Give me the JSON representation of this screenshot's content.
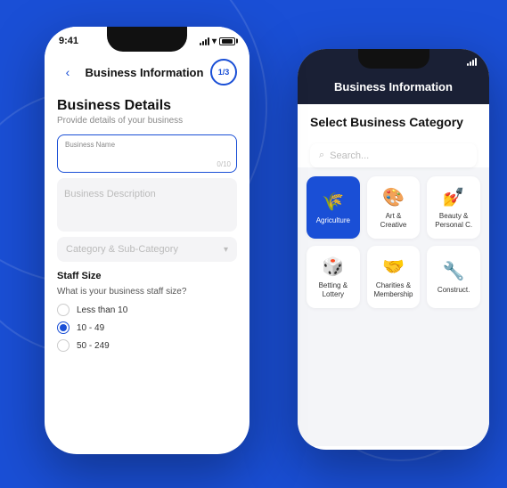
{
  "background_color": "#1a4fd6",
  "phone_main": {
    "status_bar": {
      "time": "9:41"
    },
    "header": {
      "back_label": "‹",
      "title": "Business Information",
      "step": "1/3"
    },
    "content": {
      "section_title": "Business Details",
      "section_subtitle": "Provide details of your business",
      "business_name_label": "Business Name",
      "business_name_value": "",
      "business_name_count": "0/10",
      "business_description_placeholder": "Business Description",
      "category_placeholder": "Category & Sub-Category",
      "staff_label": "Staff Size",
      "staff_question": "What is your business staff size?",
      "radio_options": [
        {
          "label": "Less than 10",
          "selected": false
        },
        {
          "label": "10 - 49",
          "selected": true
        },
        {
          "label": "50 - 249",
          "selected": false
        }
      ]
    }
  },
  "phone_secondary": {
    "header": {
      "title": "Business Information"
    },
    "content": {
      "section_title": "Select Business Category",
      "search_placeholder": "Search...",
      "categories_row1": [
        {
          "name": "Agriculture",
          "icon": "🌾",
          "active": true
        },
        {
          "name": "Art & Creative",
          "icon": "🎨",
          "active": false
        },
        {
          "name": "Beauty & Personal C.",
          "icon": "💅",
          "active": false
        }
      ],
      "categories_row2": [
        {
          "name": "Betting & Lottery",
          "icon": "🎲",
          "active": false
        },
        {
          "name": "Charities & Membership",
          "icon": "🤝",
          "active": false
        },
        {
          "name": "Construct.",
          "icon": "🔧",
          "active": false
        }
      ]
    }
  }
}
